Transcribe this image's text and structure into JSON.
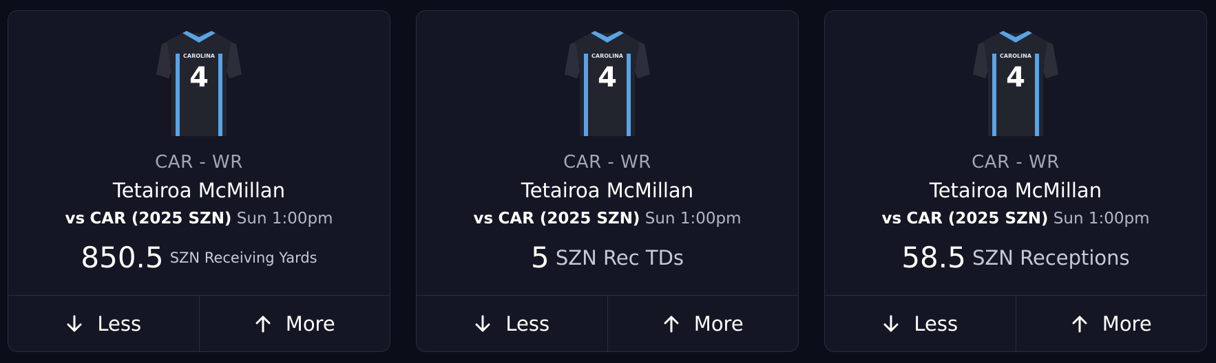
{
  "cards": [
    {
      "jersey": {
        "team_text": "CAROLINA",
        "number": "4",
        "icon": "jersey-icon"
      },
      "position": "CAR - WR",
      "player_name": "Tetairoa McMillan",
      "matchup_prefix": "vs",
      "matchup_team": "CAR (2025 SZN)",
      "game_time": "Sun 1:00pm",
      "line_value": "850.5",
      "stat_label": "SZN Receiving Yards",
      "less_label": "Less",
      "more_label": "More"
    },
    {
      "jersey": {
        "team_text": "CAROLINA",
        "number": "4",
        "icon": "jersey-icon"
      },
      "position": "CAR - WR",
      "player_name": "Tetairoa McMillan",
      "matchup_prefix": "vs",
      "matchup_team": "CAR (2025 SZN)",
      "game_time": "Sun 1:00pm",
      "line_value": "5",
      "stat_label": "SZN Rec TDs",
      "less_label": "Less",
      "more_label": "More"
    },
    {
      "jersey": {
        "team_text": "CAROLINA",
        "number": "4",
        "icon": "jersey-icon"
      },
      "position": "CAR - WR",
      "player_name": "Tetairoa McMillan",
      "matchup_prefix": "vs",
      "matchup_team": "CAR (2025 SZN)",
      "game_time": "Sun 1:00pm",
      "line_value": "58.5",
      "stat_label": "SZN Receptions",
      "less_label": "Less",
      "more_label": "More"
    }
  ],
  "colors": {
    "background": "#0b0d18",
    "card": "#141623",
    "border": "#2a2d3b",
    "jersey_body": "#22242e",
    "jersey_accent": "#5aa3e6"
  }
}
